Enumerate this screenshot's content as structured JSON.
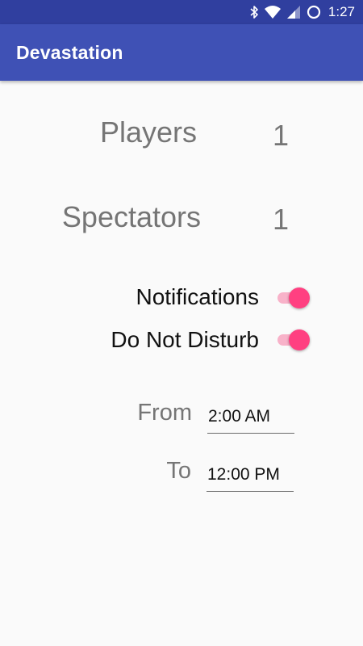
{
  "status_bar": {
    "time": "1:27",
    "icons": [
      "bluetooth-icon",
      "wifi-icon",
      "cell-signal-icon",
      "sync-icon"
    ]
  },
  "app_bar": {
    "title": "Devastation",
    "color": "#3f51b5",
    "status_color": "#303f9f"
  },
  "stats": {
    "players_label": "Players",
    "players_value": "1",
    "spectators_label": "Spectators",
    "spectators_value": "1"
  },
  "settings": {
    "notifications_label": "Notifications",
    "notifications_on": true,
    "dnd_label": "Do Not Disturb",
    "dnd_on": true,
    "accent_color": "#ff4081"
  },
  "schedule": {
    "from_label": "From",
    "from_value": "2:00 AM",
    "to_label": "To",
    "to_value": "12:00 PM"
  }
}
